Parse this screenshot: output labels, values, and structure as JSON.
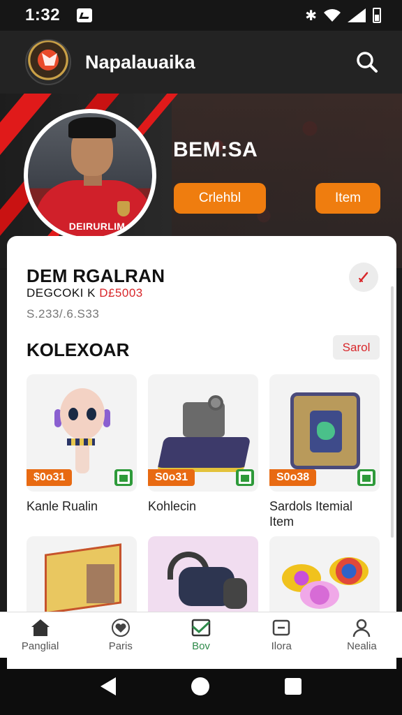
{
  "status_bar": {
    "time": "1:32",
    "bluetooth_icon": "bluetooth-icon"
  },
  "app_bar": {
    "title": "Napalauaika",
    "search_icon": "search-icon"
  },
  "hero": {
    "name": "BEM:SA",
    "jersey_text": "DEIRURLIM",
    "buttons": [
      "Crlehbl",
      "Item"
    ]
  },
  "profile": {
    "title": "DEM RGALRAN",
    "subtitle_prefix": "DEGCOKI K ",
    "subtitle_highlight": "D£5003",
    "stat": "S.233/.6.S33"
  },
  "collection": {
    "title": "KOLEXOAR",
    "action": "Sarol",
    "items": [
      {
        "price": "$0o31",
        "label": "Kanle Rualin"
      },
      {
        "price": "S0o31",
        "label": "Kohlecin"
      },
      {
        "price": "S0o38",
        "label": "Sardols Itemial Item"
      },
      {
        "price": "",
        "label": ""
      },
      {
        "price": "",
        "label": ""
      },
      {
        "price": "",
        "label": ""
      }
    ]
  },
  "bottom_nav": [
    {
      "label": "Panglial",
      "icon": "home-icon"
    },
    {
      "label": "Paris",
      "icon": "heart-icon"
    },
    {
      "label": "Bov",
      "icon": "gallery-icon"
    },
    {
      "label": "Ilora",
      "icon": "inbox-icon"
    },
    {
      "label": "Nealia",
      "icon": "profile-icon"
    }
  ],
  "colors": {
    "accent": "#ef7d0f",
    "brand_red": "#e01a1a",
    "active_green": "#2e8a4a"
  }
}
